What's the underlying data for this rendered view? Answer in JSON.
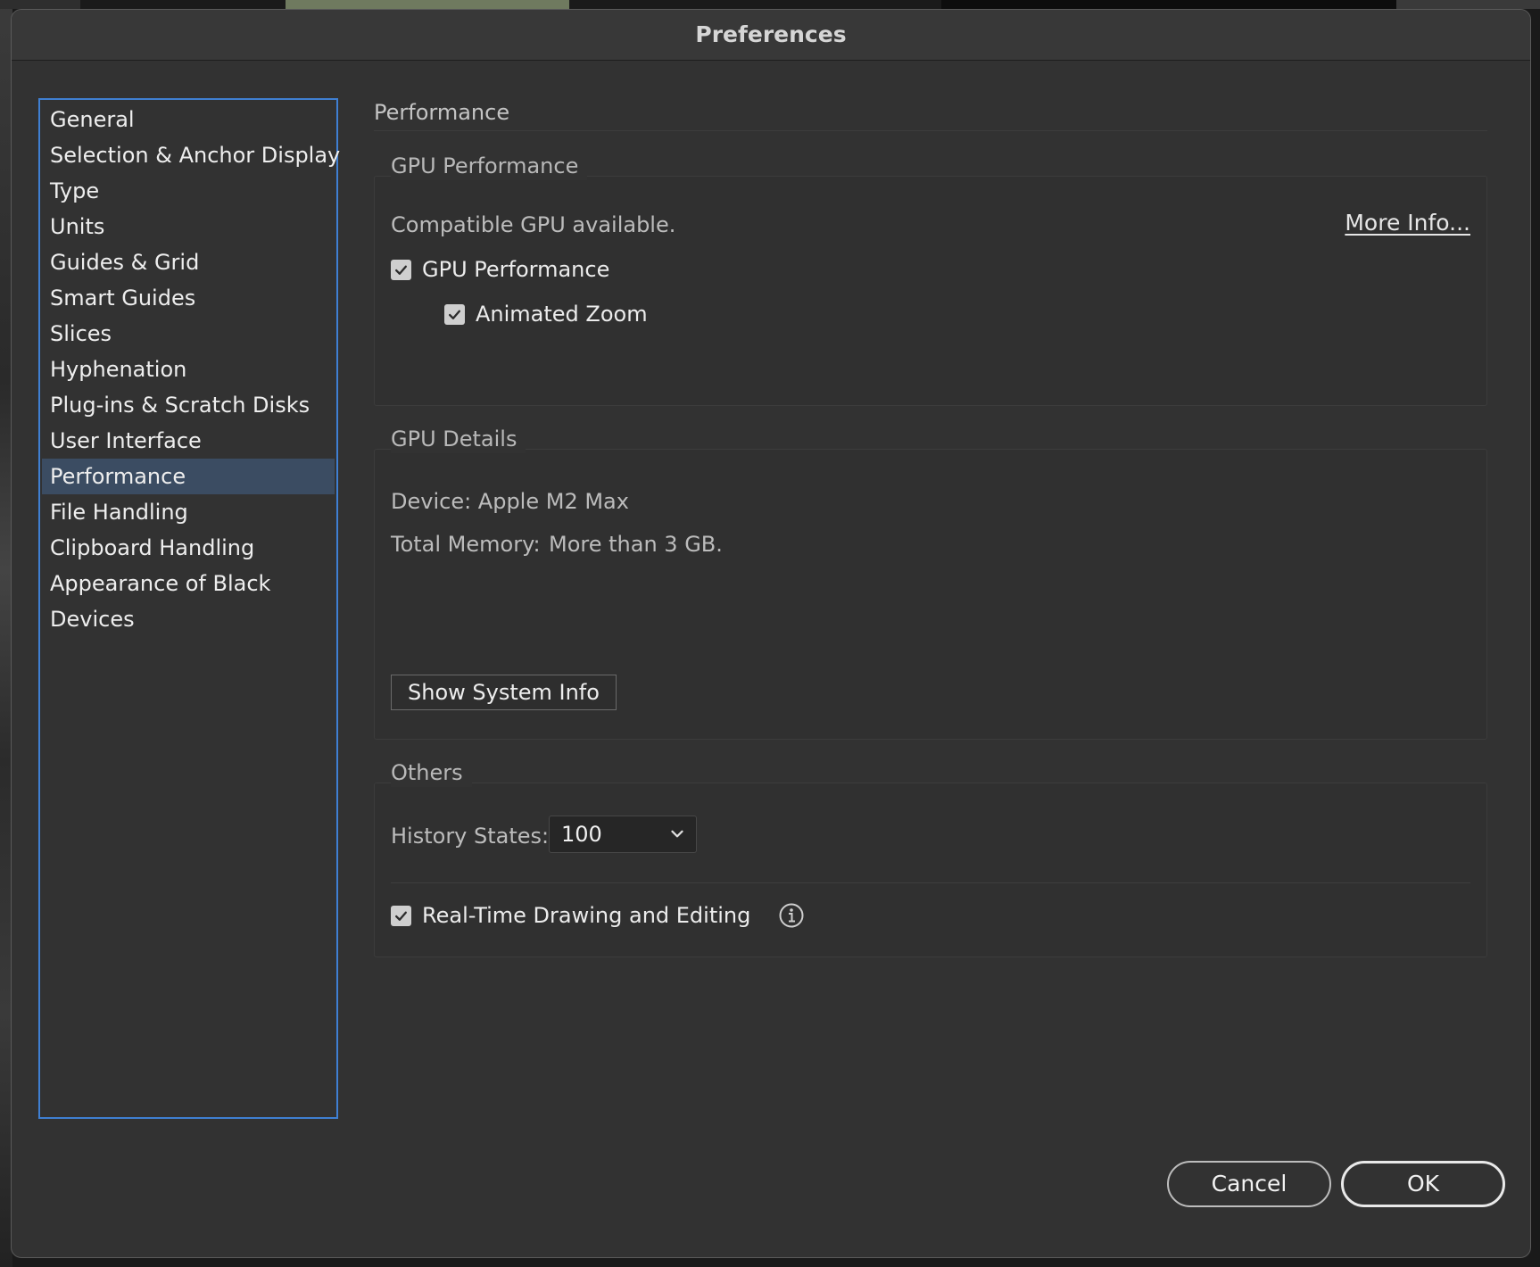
{
  "dialog": {
    "title": "Preferences"
  },
  "sidebar": {
    "items": [
      {
        "label": "General",
        "selected": false
      },
      {
        "label": "Selection & Anchor Display",
        "selected": false
      },
      {
        "label": "Type",
        "selected": false
      },
      {
        "label": "Units",
        "selected": false
      },
      {
        "label": "Guides & Grid",
        "selected": false
      },
      {
        "label": "Smart Guides",
        "selected": false
      },
      {
        "label": "Slices",
        "selected": false
      },
      {
        "label": "Hyphenation",
        "selected": false
      },
      {
        "label": "Plug-ins & Scratch Disks",
        "selected": false
      },
      {
        "label": "User Interface",
        "selected": false
      },
      {
        "label": "Performance",
        "selected": true
      },
      {
        "label": "File Handling",
        "selected": false
      },
      {
        "label": "Clipboard Handling",
        "selected": false
      },
      {
        "label": "Appearance of Black",
        "selected": false
      },
      {
        "label": "Devices",
        "selected": false
      }
    ]
  },
  "main": {
    "section_title": "Performance",
    "gpu_performance": {
      "legend": "GPU Performance",
      "status_text": "Compatible GPU available.",
      "more_info_label": "More Info...",
      "gpu_checkbox_label": "GPU Performance",
      "gpu_checked": true,
      "animated_zoom_label": "Animated Zoom",
      "animated_zoom_checked": true
    },
    "gpu_details": {
      "legend": "GPU Details",
      "device_text": "Device: Apple M2 Max",
      "memory_label": "Total Memory:",
      "memory_value": "More than 3 GB.",
      "show_system_info_label": "Show System Info"
    },
    "others": {
      "legend": "Others",
      "history_states_label": "History States:",
      "history_states_value": "100",
      "realtime_label": "Real-Time Drawing and Editing",
      "realtime_checked": true
    }
  },
  "footer": {
    "cancel_label": "Cancel",
    "ok_label": "OK"
  },
  "colors": {
    "dialog_bg": "#323232",
    "selection_bg": "#3b4c62",
    "focus_border": "#3f7fd2"
  }
}
